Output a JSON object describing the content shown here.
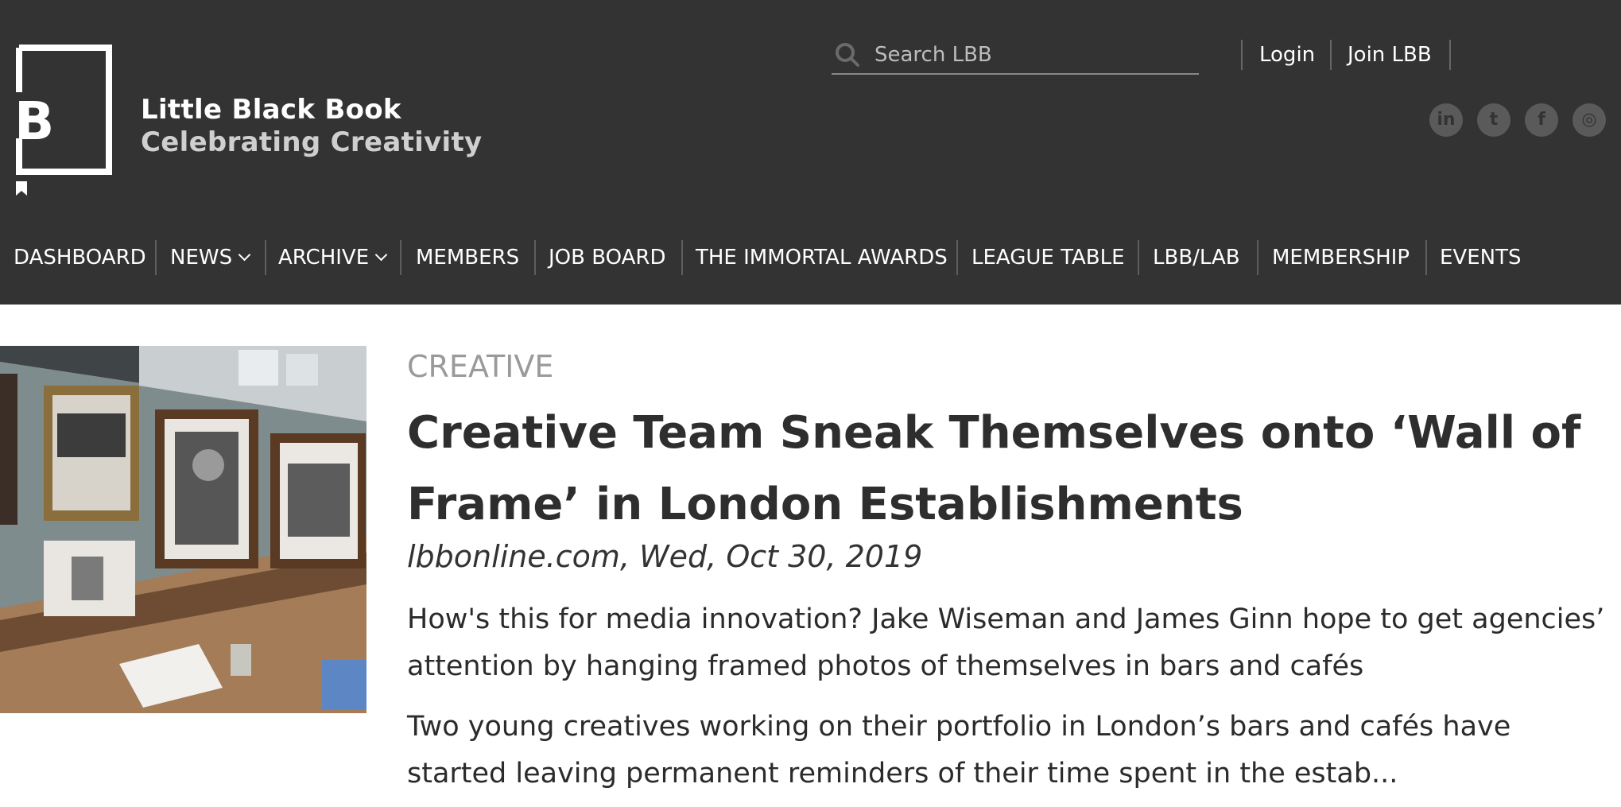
{
  "header": {
    "brand_name": "Little Black Book",
    "tagline": "Celebrating Creativity",
    "logo_letter": "B",
    "search_placeholder": "Search LBB",
    "login_label": "Login",
    "join_label": "Join LBB",
    "social": [
      {
        "name": "linkedin-icon",
        "glyph": "in"
      },
      {
        "name": "twitter-icon",
        "glyph": "t"
      },
      {
        "name": "facebook-icon",
        "glyph": "f"
      },
      {
        "name": "instagram-icon",
        "glyph": "◎"
      }
    ]
  },
  "nav": {
    "items": [
      {
        "label": "DASHBOARD"
      },
      {
        "label": "NEWS"
      },
      {
        "label": "ARCHIVE"
      },
      {
        "label": "MEMBERS"
      },
      {
        "label": "JOB BOARD"
      },
      {
        "label": "THE IMMORTAL AWARDS"
      },
      {
        "label": "LEAGUE TABLE"
      },
      {
        "label": "LBB/LAB"
      },
      {
        "label": "MEMBERSHIP"
      },
      {
        "label": "EVENTS"
      }
    ]
  },
  "article": {
    "category": "CREATIVE",
    "title": "Creative Team Sneak Themselves onto ‘Wall of Frame’ in London Establishments",
    "meta": "lbbonline.com, Wed, Oct 30, 2019",
    "summary": "How's this for media innovation? Jake Wiseman and James Ginn hope to get agencies’ attention by hanging framed photos of themselves in bars and cafés",
    "body": "Two young creatives working on their portfolio in London’s bars and cafés have started leaving permanent reminders of their time spent in the estab..."
  },
  "colors": {
    "header_bg": "#333333",
    "category": "#9a9a9a",
    "title": "#2e2e2e"
  }
}
